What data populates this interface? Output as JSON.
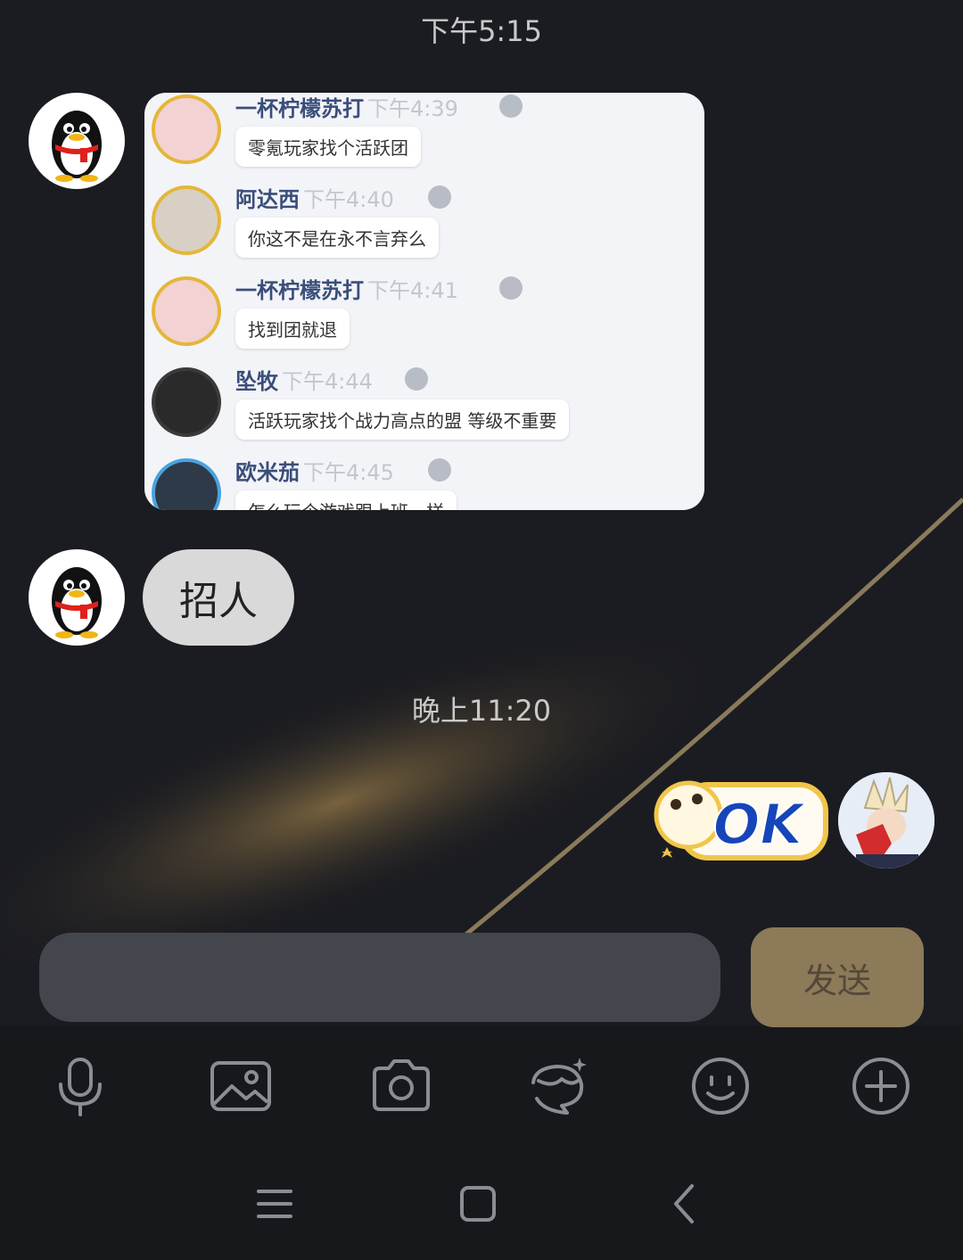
{
  "chat": {
    "time_top": "下午5:15",
    "time_mid": "晚上11:20",
    "text_message": "招人",
    "sticker_text": "OK"
  },
  "screenshot": {
    "rows": [
      {
        "name": "一杯柠檬苏打",
        "time": "下午4:39",
        "text": "零氪玩家找个活跃团"
      },
      {
        "name": "阿达西",
        "time": "下午4:40",
        "text": "你这不是在永不言弃么"
      },
      {
        "name": "一杯柠檬苏打",
        "time": "下午4:41",
        "text": "找到团就退"
      },
      {
        "name": "坠牧",
        "time": "下午4:44",
        "text": "活跃玩家找个战力高点的盟 等级不重要"
      },
      {
        "name": "欧米茄",
        "time": "下午4:45",
        "text": "怎么玩个游戏跟上班一样"
      }
    ]
  },
  "input": {
    "placeholder": "",
    "send_label": "发送"
  },
  "toolbar": {
    "icons": [
      "microphone-icon",
      "image-icon",
      "camera-icon",
      "ai-assistant-icon",
      "emoji-icon",
      "plus-icon"
    ]
  },
  "nav": {
    "icons": [
      "menu-icon",
      "home-icon",
      "back-icon"
    ]
  },
  "colors": {
    "background": "#1b1c21",
    "send_button": "#8c7a58",
    "input_box": "#44464e",
    "bubble": "#d9d9d9"
  }
}
